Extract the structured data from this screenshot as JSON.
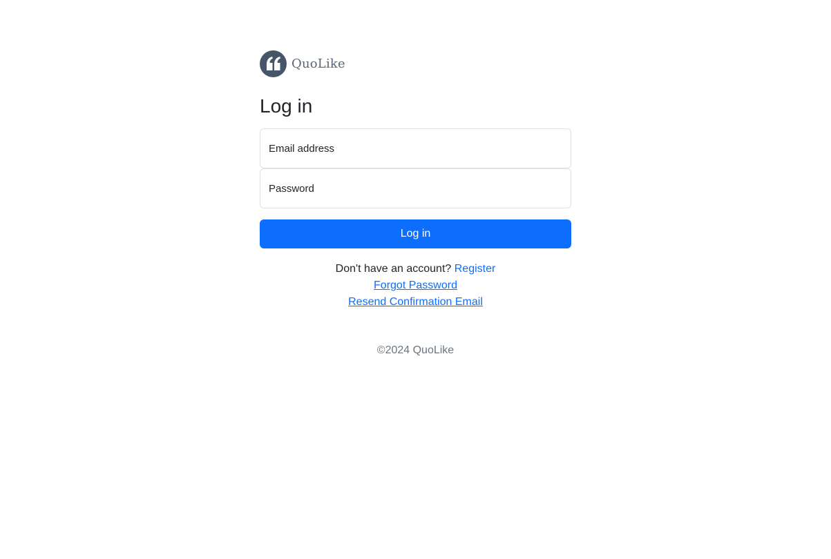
{
  "brand": {
    "name": "QuoLike",
    "logo_icon": "quote-icon",
    "logo_color": "#475569"
  },
  "login": {
    "title": "Log in",
    "email_placeholder": "Email address",
    "password_placeholder": "Password",
    "submit_label": "Log in",
    "accent_color": "#0d6efd"
  },
  "links": {
    "no_account_text": "Don't have an account?",
    "register_label": "Register",
    "forgot_password_label": "Forgot Password",
    "resend_confirmation_label": "Resend Confirmation Email"
  },
  "footer": {
    "copyright": "©2024 QuoLike"
  }
}
